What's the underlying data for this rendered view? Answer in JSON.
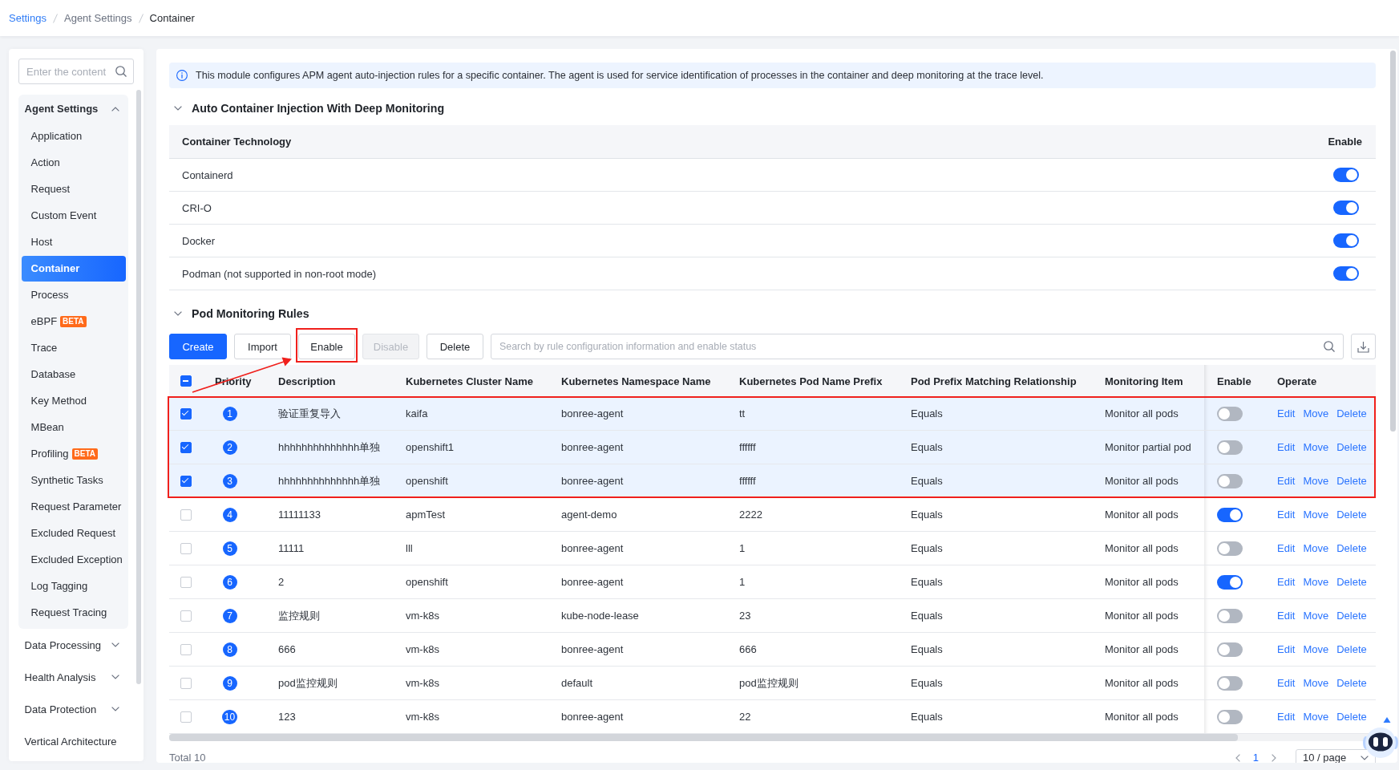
{
  "breadcrumb": [
    {
      "label": "Settings",
      "kind": "link"
    },
    {
      "label": "Agent Settings",
      "kind": "parent"
    },
    {
      "label": "Container",
      "kind": "current"
    }
  ],
  "sidebar": {
    "search": {
      "placeholder": "Enter the content"
    },
    "groups": [
      {
        "label": "Agent Settings",
        "kind": "group",
        "expanded": true,
        "children": [
          {
            "label": "Application",
            "selected": false
          },
          {
            "label": "Action",
            "selected": false
          },
          {
            "label": "Request",
            "selected": false
          },
          {
            "label": "Custom Event",
            "selected": false
          },
          {
            "label": "Host",
            "selected": false
          },
          {
            "label": "Container",
            "selected": true
          },
          {
            "label": "Process",
            "selected": false
          },
          {
            "label": "eBPF",
            "badge": "BETA",
            "selected": false
          },
          {
            "label": "Trace",
            "selected": false
          },
          {
            "label": "Database",
            "selected": false
          },
          {
            "label": "Key Method",
            "selected": false
          },
          {
            "label": "MBean",
            "selected": false
          },
          {
            "label": "Profiling",
            "badge": "BETA",
            "selected": false
          },
          {
            "label": "Synthetic Tasks",
            "selected": false
          },
          {
            "label": "Request Parameter",
            "selected": false
          },
          {
            "label": "Excluded Request",
            "selected": false
          },
          {
            "label": "Excluded Exception",
            "selected": false
          },
          {
            "label": "Log Tagging",
            "selected": false
          },
          {
            "label": "Request Tracing",
            "selected": false
          }
        ]
      },
      {
        "label": "Data Processing",
        "kind": "group",
        "expanded": false
      },
      {
        "label": "Health Analysis",
        "kind": "group",
        "expanded": false
      },
      {
        "label": "Data Protection",
        "kind": "group",
        "expanded": false
      },
      {
        "label": "Vertical Architecture",
        "kind": "link"
      }
    ]
  },
  "notice": {
    "text": "This module configures APM agent auto-injection rules for a specific container. The agent is used for service identification of processes in the container and deep monitoring at the trace level."
  },
  "injection": {
    "title": "Auto Container Injection With Deep Monitoring",
    "expanded": true,
    "columns": [
      "Container Technology",
      "Enable"
    ],
    "rows": [
      {
        "name": "Containerd",
        "on": true
      },
      {
        "name": "CRI-O",
        "on": true
      },
      {
        "name": "Docker",
        "on": true
      },
      {
        "name": "Podman (not supported in non-root mode)",
        "on": true
      }
    ]
  },
  "rules": {
    "title": "Pod Monitoring Rules",
    "expanded": true,
    "buttons": [
      {
        "label": "Create",
        "kind": "primary",
        "disabled": false,
        "highlighted": false
      },
      {
        "label": "Import",
        "kind": "default",
        "disabled": false,
        "highlighted": false
      },
      {
        "label": "Enable",
        "kind": "default",
        "disabled": false,
        "highlighted": true
      },
      {
        "label": "Disable",
        "kind": "default",
        "disabled": true,
        "highlighted": false
      },
      {
        "label": "Delete",
        "kind": "default",
        "disabled": false,
        "highlighted": false
      }
    ],
    "search": {
      "placeholder": "Search by rule configuration information and enable status"
    },
    "table": {
      "select_all": {
        "indeterminate": true
      },
      "columns": [
        "Priority",
        "Description",
        "Kubernetes Cluster Name",
        "Kubernetes Namespace Name",
        "Kubernetes Pod Name Prefix",
        "Pod Prefix Matching Relationship",
        "Monitoring Item",
        "Enable",
        "Operate"
      ],
      "rows": [
        {
          "selected": true,
          "highlighted": true,
          "priority": "1",
          "description": "验证重复导入",
          "cluster": "kaifa",
          "namespace": "bonree-agent",
          "pod_prefix": "tt",
          "matching": "Equals",
          "monitoring_item": "Monitor all pods",
          "enabled": false,
          "actions": [
            "Edit",
            "Move",
            "Delete"
          ]
        },
        {
          "selected": true,
          "highlighted": true,
          "priority": "2",
          "description": "hhhhhhhhhhhhhh单独",
          "cluster": "openshift1",
          "namespace": "bonree-agent",
          "pod_prefix": "ffffff",
          "matching": "Equals",
          "monitoring_item": "Monitor partial pod",
          "enabled": false,
          "actions": [
            "Edit",
            "Move",
            "Delete"
          ]
        },
        {
          "selected": true,
          "highlighted": true,
          "priority": "3",
          "description": "hhhhhhhhhhhhhh单独",
          "cluster": "openshift",
          "namespace": "bonree-agent",
          "pod_prefix": "ffffff",
          "matching": "Equals",
          "monitoring_item": "Monitor all pods",
          "enabled": false,
          "actions": [
            "Edit",
            "Move",
            "Delete"
          ]
        },
        {
          "selected": false,
          "highlighted": false,
          "priority": "4",
          "description": "11111133",
          "cluster": "apmTest",
          "namespace": "agent-demo",
          "pod_prefix": "2222",
          "matching": "Equals",
          "monitoring_item": "Monitor all pods",
          "enabled": true,
          "actions": [
            "Edit",
            "Move",
            "Delete"
          ]
        },
        {
          "selected": false,
          "highlighted": false,
          "priority": "5",
          "description": "11111",
          "cluster": "lll",
          "namespace": "bonree-agent",
          "pod_prefix": "1",
          "matching": "Equals",
          "monitoring_item": "Monitor all pods",
          "enabled": false,
          "actions": [
            "Edit",
            "Move",
            "Delete"
          ]
        },
        {
          "selected": false,
          "highlighted": false,
          "priority": "6",
          "description": "2",
          "cluster": "openshift",
          "namespace": "bonree-agent",
          "pod_prefix": "1",
          "matching": "Equals",
          "monitoring_item": "Monitor all pods",
          "enabled": true,
          "actions": [
            "Edit",
            "Move",
            "Delete"
          ]
        },
        {
          "selected": false,
          "highlighted": false,
          "priority": "7",
          "description": "监控规则",
          "cluster": "vm-k8s",
          "namespace": "kube-node-lease",
          "pod_prefix": "23",
          "matching": "Equals",
          "monitoring_item": "Monitor all pods",
          "enabled": false,
          "actions": [
            "Edit",
            "Move",
            "Delete"
          ]
        },
        {
          "selected": false,
          "highlighted": false,
          "priority": "8",
          "description": "666",
          "cluster": "vm-k8s",
          "namespace": "bonree-agent",
          "pod_prefix": "666",
          "matching": "Equals",
          "monitoring_item": "Monitor all pods",
          "enabled": false,
          "actions": [
            "Edit",
            "Move",
            "Delete"
          ]
        },
        {
          "selected": false,
          "highlighted": false,
          "priority": "9",
          "description": "pod监控规则",
          "cluster": "vm-k8s",
          "namespace": "default",
          "pod_prefix": "pod监控规则",
          "matching": "Equals",
          "monitoring_item": "Monitor all pods",
          "enabled": false,
          "actions": [
            "Edit",
            "Move",
            "Delete"
          ]
        },
        {
          "selected": false,
          "highlighted": false,
          "priority": "10",
          "description": "123",
          "cluster": "vm-k8s",
          "namespace": "bonree-agent",
          "pod_prefix": "22",
          "matching": "Equals",
          "monitoring_item": "Monitor all pods",
          "enabled": false,
          "actions": [
            "Edit",
            "Move",
            "Delete"
          ]
        }
      ]
    },
    "footer": {
      "total": "Total 10",
      "pages": [
        {
          "label": "1",
          "selected": true
        }
      ],
      "page_size": "10 / page"
    }
  }
}
